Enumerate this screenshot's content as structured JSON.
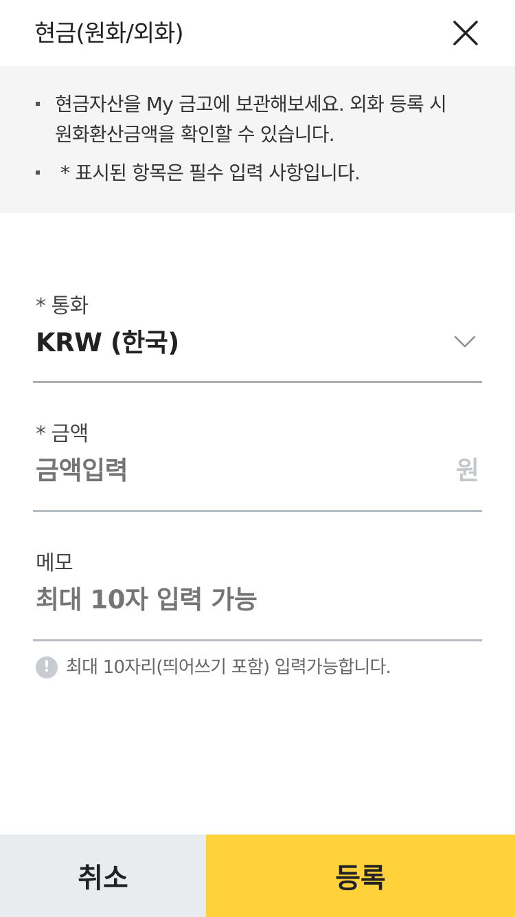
{
  "header": {
    "title": "현금(원화/외화)",
    "close_icon": "close-icon"
  },
  "notice": {
    "items": [
      "현금자산을 My 금고에 보관해보세요. 외화 등록 시 원화환산금액을 확인할 수 있습니다.",
      "* 표시된 항목은 필수 입력 사항입니다."
    ]
  },
  "form": {
    "currency": {
      "required_mark": "*",
      "label": "통화",
      "value": "KRW (한국)",
      "icon": "chevron-down-icon"
    },
    "amount": {
      "required_mark": "*",
      "label": "금액",
      "placeholder": "금액입력",
      "unit": "원"
    },
    "memo": {
      "label": "메모",
      "placeholder": "최대 10자 입력 가능",
      "hint_icon": "exclamation-icon",
      "hint_icon_glyph": "!",
      "hint": "최대 10자리(띄어쓰기 포함) 입력가능합니다."
    }
  },
  "buttons": {
    "cancel": "취소",
    "submit": "등록"
  },
  "colors": {
    "notice_bg": "#f5f5f5",
    "submit_bg": "#ffd23c",
    "cancel_bg": "#e9ecef",
    "placeholder": "#c4c8cc"
  }
}
